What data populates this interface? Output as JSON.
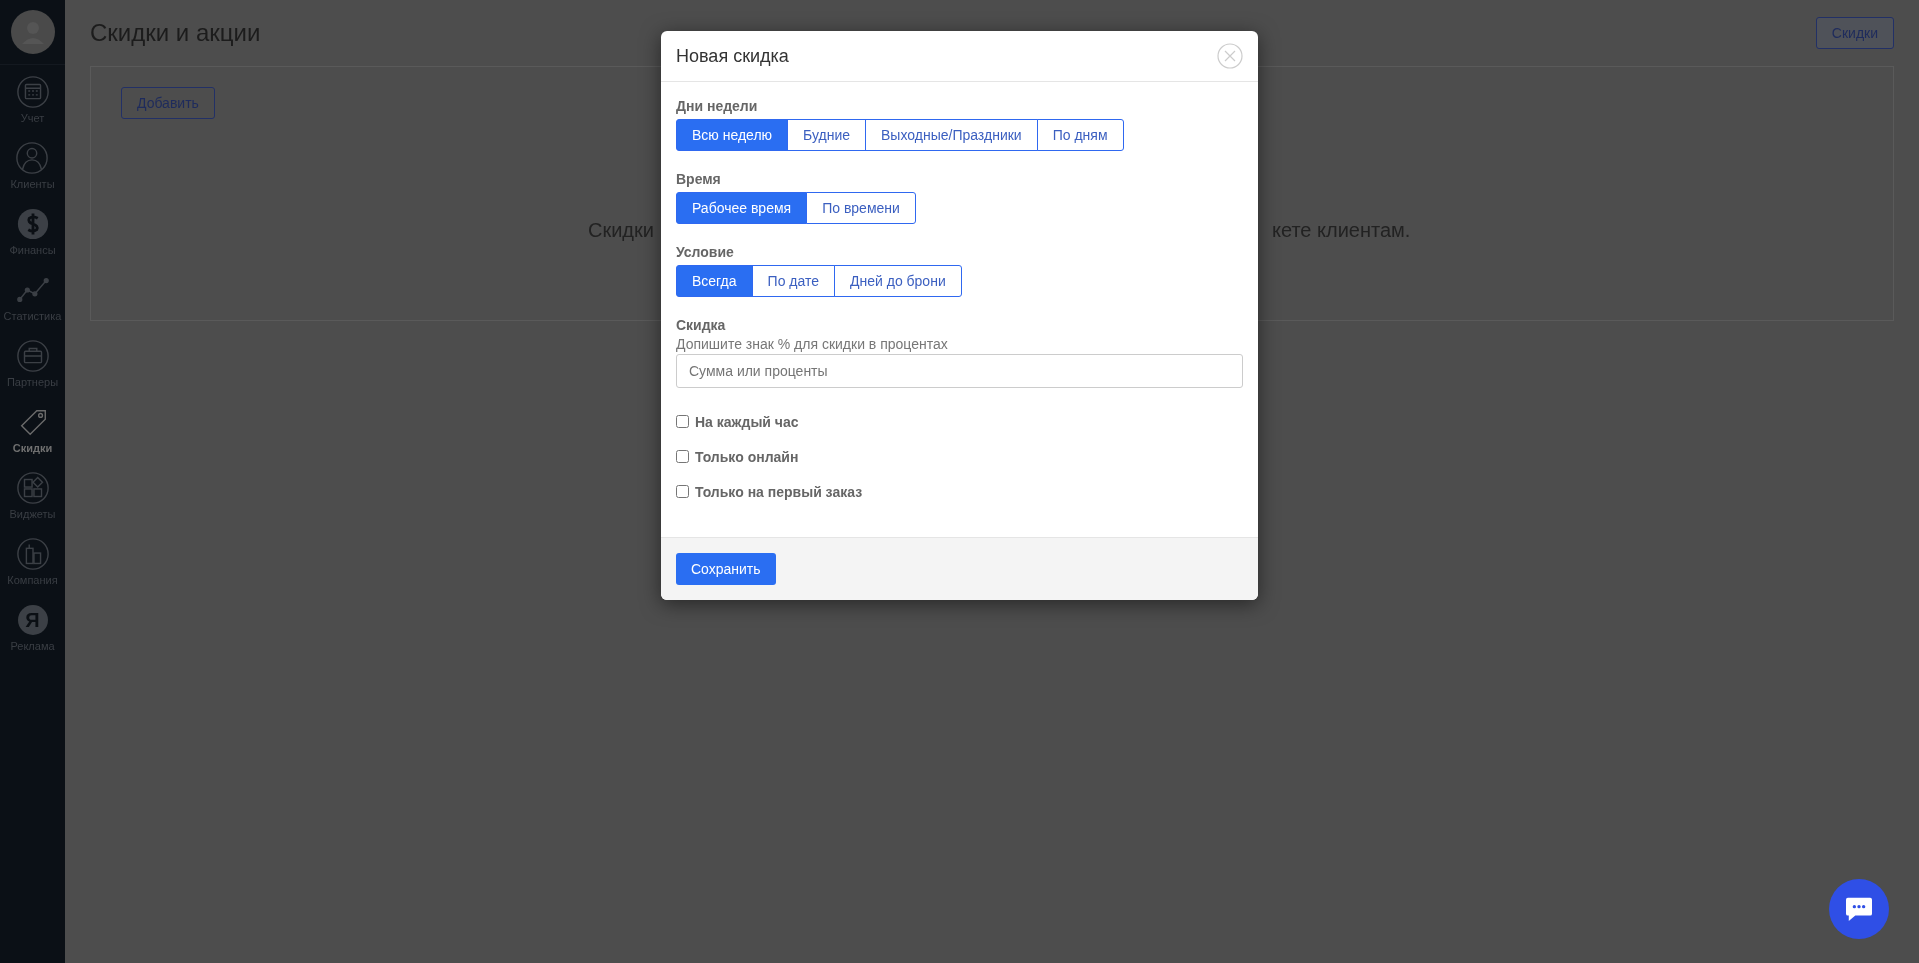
{
  "sidebar": {
    "items": [
      {
        "label": "Учет",
        "selected": false
      },
      {
        "label": "Клиенты",
        "selected": false
      },
      {
        "label": "Финансы",
        "selected": false
      },
      {
        "label": "Статистика",
        "selected": false
      },
      {
        "label": "Партнеры",
        "selected": false
      },
      {
        "label": "Скидки",
        "selected": true
      },
      {
        "label": "Виджеты",
        "selected": false
      },
      {
        "label": "Компания",
        "selected": false
      },
      {
        "label": "Реклама",
        "selected": false,
        "badge": "Я"
      }
    ]
  },
  "page": {
    "title": "Скидки и акции",
    "header_button": "Скидки",
    "add_button": "Добавить",
    "empty_text_left": "Скидки",
    "empty_text_right": "кете клиентам."
  },
  "modal": {
    "title": "Новая скидка",
    "groups": [
      {
        "label": "Дни недели",
        "options": [
          {
            "label": "Всю неделю",
            "selected": true
          },
          {
            "label": "Будние",
            "selected": false
          },
          {
            "label": "Выходные/Праздники",
            "selected": false
          },
          {
            "label": "По дням",
            "selected": false
          }
        ]
      },
      {
        "label": "Время",
        "options": [
          {
            "label": "Рабочее время",
            "selected": true
          },
          {
            "label": "По времени",
            "selected": false
          }
        ]
      },
      {
        "label": "Условие",
        "options": [
          {
            "label": "Всегда",
            "selected": true
          },
          {
            "label": "По дате",
            "selected": false
          },
          {
            "label": "Дней до брони",
            "selected": false
          }
        ]
      }
    ],
    "discount": {
      "label": "Скидка",
      "hint": "Допишите знак % для скидки в процентах",
      "placeholder": "Сумма или проценты"
    },
    "checkboxes": [
      {
        "label": "На каждый час",
        "checked": false
      },
      {
        "label": "Только онлайн",
        "checked": false
      },
      {
        "label": "Только на первый заказ",
        "checked": false
      }
    ],
    "save_button": "Сохранить"
  }
}
